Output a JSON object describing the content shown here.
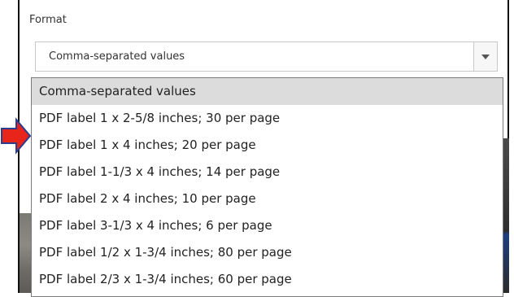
{
  "format": {
    "label": "Format",
    "selected_value": "Comma-separated values",
    "options": [
      "Comma-separated values",
      "PDF label 1 x 2-5/8 inches; 30 per page",
      "PDF label 1 x 4 inches; 20 per page",
      "PDF label 1-1/3 x 4 inches; 14 per page",
      "PDF label 2 x 4 inches; 10 per page",
      "PDF label 3-1/3 x 4 inches; 6 per page",
      "PDF label 1/2 x 1-3/4 inches; 80 per page",
      "PDF label 2/3 x 1-3/4 inches; 60 per page"
    ]
  },
  "icons": {
    "dropdown_toggle": "chevron-down-icon",
    "annotation": "red-arrow-icon"
  },
  "colors": {
    "arrow_fill": "#e8251a",
    "arrow_stroke": "#2a3d8f",
    "selected_row": "#dcdcdc"
  }
}
